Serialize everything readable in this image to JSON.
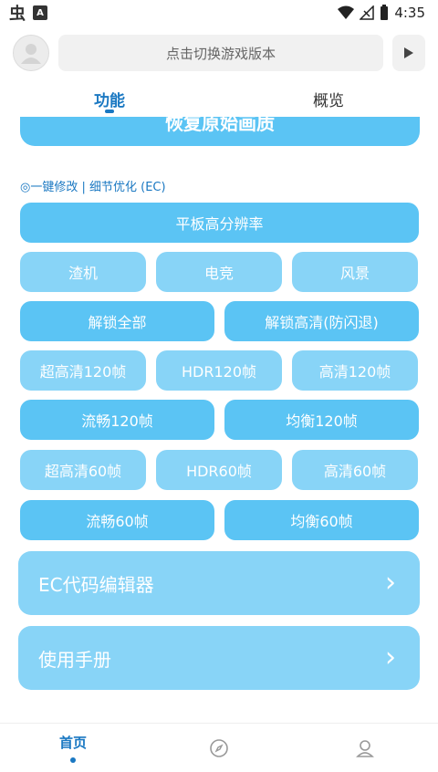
{
  "status_bar": {
    "time": "4:35",
    "left_icons": [
      "app-icon",
      "app-icon"
    ],
    "right_icons": [
      "wifi-icon",
      "signal-off-icon",
      "battery-icon"
    ]
  },
  "header": {
    "version_placeholder": "点击切换游戏版本",
    "avatar_icon": "user-avatar-icon",
    "play_icon": "play-icon"
  },
  "tabs": [
    {
      "label": "功能",
      "active": true
    },
    {
      "label": "概览",
      "active": false
    }
  ],
  "main": {
    "restore_button": "恢复原始画质",
    "section_label": "◎一键修改 | 细节优化 (EC)",
    "tablet_button": "平板高分辨率",
    "row1": [
      "渣机",
      "电竞",
      "风景"
    ],
    "row2": [
      "解锁全部",
      "解锁高清(防闪退)"
    ],
    "row3": [
      "超高清120帧",
      "HDR120帧",
      "高清120帧"
    ],
    "row4": [
      "流畅120帧",
      "均衡120帧"
    ],
    "row5": [
      "超高清60帧",
      "HDR60帧",
      "高清60帧"
    ],
    "row6": [
      "流畅60帧",
      "均衡60帧"
    ],
    "editor_button": "EC代码编辑器",
    "manual_button": "使用手册"
  },
  "bottom_nav": [
    {
      "label": "首页",
      "active": true
    },
    {
      "label": "",
      "icon": "compass-icon"
    },
    {
      "label": "",
      "icon": "profile-icon"
    }
  ],
  "colors": {
    "accent": "#1a78c2",
    "button_dark": "#5bc4f4",
    "button_light": "#88d4f7"
  }
}
